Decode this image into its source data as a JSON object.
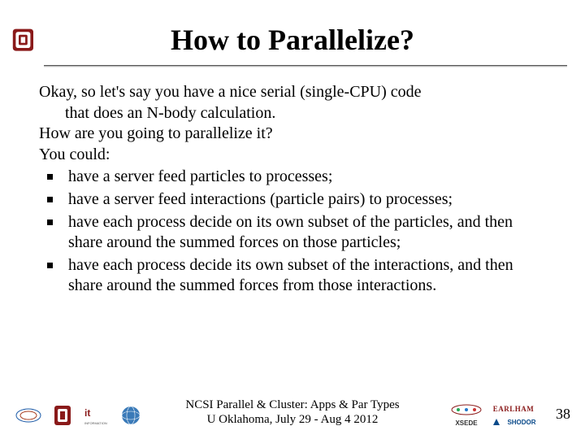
{
  "header": {
    "title": "How to Parallelize?",
    "logo_name": "ou-logo"
  },
  "content": {
    "intro_line1": "Okay, so let's say you have a nice serial (single-CPU) code",
    "intro_line2": "that does an N-body calculation.",
    "q_line": "How are you going to parallelize it?",
    "lead_in": "You could:",
    "bullets": [
      "have a server feed particles to processes;",
      "have a server feed interactions (particle pairs) to processes;",
      "have each process decide on its own subset of the particles, and then share around the summed forces on those particles;",
      "have each process decide its own subset of the interactions, and then share around the summed forces from those interactions."
    ]
  },
  "footer": {
    "text_line1": "NCSI Parallel & Cluster: Apps & Par Types",
    "text_line2": "U Oklahoma, July 29 - Aug 4 2012",
    "page_number": "38",
    "left_logos": [
      "oscer-logo",
      "ou-small-logo",
      "it-logo",
      "globe-logo"
    ],
    "right_logos": [
      "sc-logo",
      "earlham-logo",
      "xsede-logo",
      "shodor-logo"
    ],
    "earlham_label": "EARLHAM",
    "xsede_label": "XSEDE",
    "shodor_label": "SHODOR"
  }
}
